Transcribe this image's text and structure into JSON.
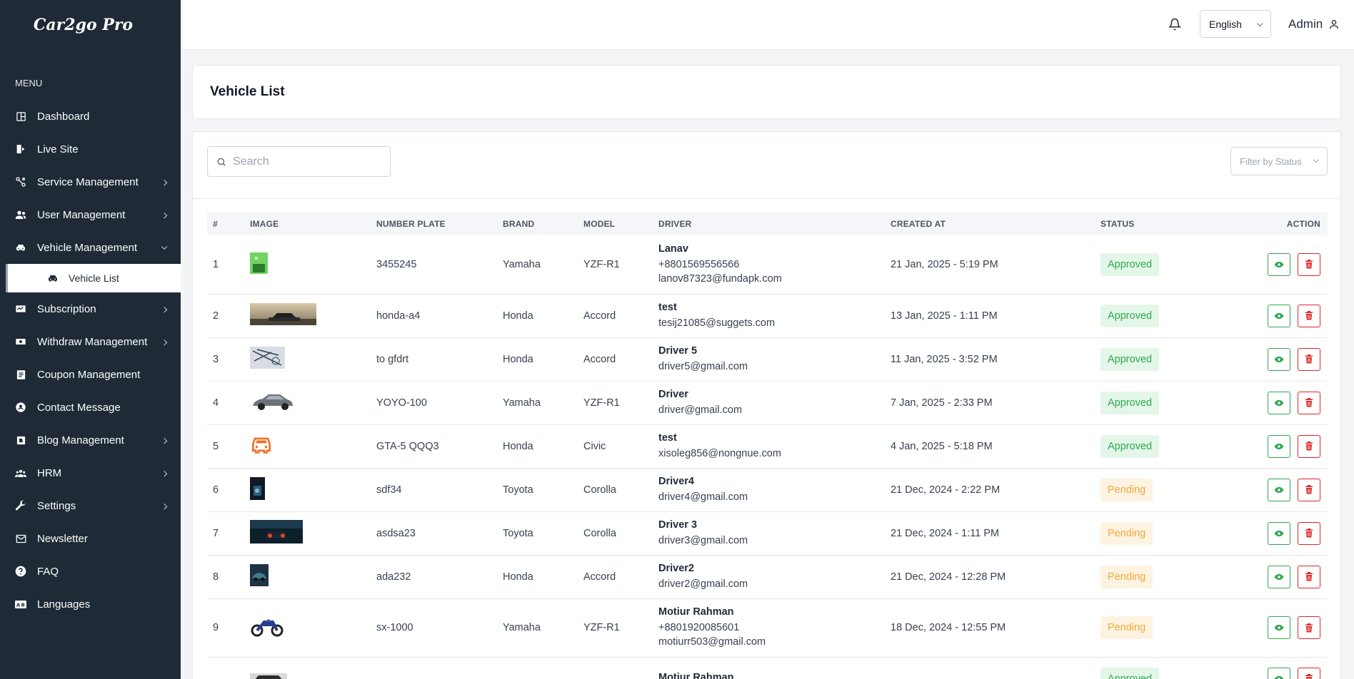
{
  "app": {
    "logo": "Car2go Pro"
  },
  "sidebar": {
    "menu_title": "MENU",
    "items": [
      {
        "label": "Dashboard",
        "icon": "dashboard-icon",
        "chevron": false
      },
      {
        "label": "Live Site",
        "icon": "external-site-icon",
        "chevron": false
      },
      {
        "label": "Service Management",
        "icon": "services-icon",
        "chevron": true
      },
      {
        "label": "User Management",
        "icon": "users-icon",
        "chevron": true
      },
      {
        "label": "Vehicle Management",
        "icon": "car-icon",
        "chevron": true,
        "expanded": true
      },
      {
        "label": "Subscription",
        "icon": "subscription-icon",
        "chevron": true
      },
      {
        "label": "Withdraw Management",
        "icon": "withdraw-icon",
        "chevron": true
      },
      {
        "label": "Coupon Management",
        "icon": "coupon-icon",
        "chevron": false
      },
      {
        "label": "Contact Message",
        "icon": "contact-icon",
        "chevron": false
      },
      {
        "label": "Blog Management",
        "icon": "blog-icon",
        "chevron": true
      },
      {
        "label": "HRM",
        "icon": "hrm-icon",
        "chevron": true
      },
      {
        "label": "Settings",
        "icon": "wrench-icon",
        "chevron": true
      },
      {
        "label": "Newsletter",
        "icon": "mail-icon",
        "chevron": false
      },
      {
        "label": "FAQ",
        "icon": "question-icon",
        "chevron": false
      },
      {
        "label": "Languages",
        "icon": "language-icon",
        "chevron": false
      }
    ],
    "sub_item": {
      "label": "Vehicle List",
      "icon": "car-icon"
    }
  },
  "header": {
    "language": "English",
    "user": "Admin"
  },
  "page": {
    "title": "Vehicle List",
    "search_placeholder": "Search",
    "filter_placeholder": "Filter by Status"
  },
  "table": {
    "columns": [
      "#",
      "IMAGE",
      "NUMBER PLATE",
      "BRAND",
      "MODEL",
      "DRIVER",
      "CREATED AT",
      "STATUS",
      "ACTION"
    ],
    "rows": [
      {
        "num": "1",
        "plate": "3455245",
        "brand": "Yamaha",
        "model": "YZF-R1",
        "driver": "Lanav",
        "phone": "+8801569556566",
        "email": "lanov87323@fundapk.com",
        "created": "21 Jan, 2025 - 5:19 PM",
        "status": "Approved",
        "image": "green-square-image"
      },
      {
        "num": "2",
        "plate": "honda-a4",
        "brand": "Honda",
        "model": "Accord",
        "driver": "test",
        "phone": "",
        "email": "tesij21085@suggets.com",
        "created": "13 Jan, 2025 - 1:11 PM",
        "status": "Approved",
        "image": "car-sunset-image"
      },
      {
        "num": "3",
        "plate": "to gfdrt",
        "brand": "Honda",
        "model": "Accord",
        "driver": "Driver 5",
        "phone": "",
        "email": "driver5@gmail.com",
        "created": "11 Jan, 2025 - 3:52 PM",
        "status": "Approved",
        "image": "sketch-image"
      },
      {
        "num": "4",
        "plate": "YOYO-100",
        "brand": "Yamaha",
        "model": "YZF-R1",
        "driver": "Driver",
        "phone": "",
        "email": "driver@gmail.com",
        "created": "7 Jan, 2025 - 2:33 PM",
        "status": "Approved",
        "image": "silver-sedan-image"
      },
      {
        "num": "5",
        "plate": "GTA-5 QQQ3",
        "brand": "Honda",
        "model": "Civic",
        "driver": "test",
        "phone": "",
        "email": "xisoleg856@nongnue.com",
        "created": "4 Jan, 2025 - 5:18 PM",
        "status": "Approved",
        "image": "orange-car-icon-image"
      },
      {
        "num": "6",
        "plate": "sdf34",
        "brand": "Toyota",
        "model": "Corolla",
        "driver": "Driver4",
        "phone": "",
        "email": "driver4@gmail.com",
        "created": "21 Dec, 2024 - 2:22 PM",
        "status": "Pending",
        "image": "phone-dark-image"
      },
      {
        "num": "7",
        "plate": "asdsa23",
        "brand": "Toyota",
        "model": "Corolla",
        "driver": "Driver 3",
        "phone": "",
        "email": "driver3@gmail.com",
        "created": "21 Dec, 2024 - 1:11 PM",
        "status": "Pending",
        "image": "night-car-image"
      },
      {
        "num": "8",
        "plate": "ada232",
        "brand": "Honda",
        "model": "Accord",
        "driver": "Driver2",
        "phone": "",
        "email": "driver2@gmail.com",
        "created": "21 Dec, 2024 - 12:28 PM",
        "status": "Pending",
        "image": "teal-car-image"
      },
      {
        "num": "9",
        "plate": "sx-1000",
        "brand": "Yamaha",
        "model": "YZF-R1",
        "driver": "Motiur Rahman",
        "phone": "+8801920085601",
        "email": "motiurr503@gmail.com",
        "created": "18 Dec, 2024 - 12:55 PM",
        "status": "Pending",
        "image": "motorbike-image"
      },
      {
        "num": "",
        "plate": "",
        "brand": "",
        "model": "",
        "driver": "Motiur Rahman",
        "phone": "",
        "email": "",
        "created": "",
        "status": "Approved",
        "image": "dark-car-image"
      }
    ]
  },
  "colors": {
    "sidebar_bg": "#1e2a35",
    "approved": "#2fa84f",
    "pending": "#f2a93b",
    "delete": "#dc2626"
  }
}
